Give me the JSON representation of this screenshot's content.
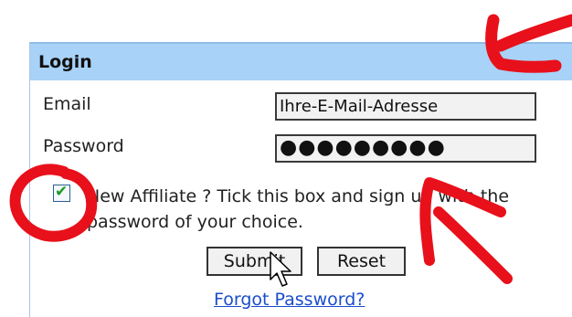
{
  "login": {
    "title": "Login",
    "email_label": "Email",
    "email_value": "Ihre-E-Mail-Adresse",
    "password_label": "Password",
    "password_value": "●●●●●●●●●",
    "affiliate_checked": true,
    "affiliate_text": "New Affiliate ? Tick this box and sign up with the password of your choice.",
    "submit_label": "Submit",
    "reset_label": "Reset",
    "forgot_link": "Forgot Password?"
  },
  "annotations": {
    "color": "#e8101a"
  },
  "colors": {
    "header_bg": "#a8d2f8",
    "link": "#1a4dcc",
    "checkmark": "#1b9b25"
  },
  "icons": [
    "checkbox-check-icon",
    "mouse-cursor-icon"
  ]
}
